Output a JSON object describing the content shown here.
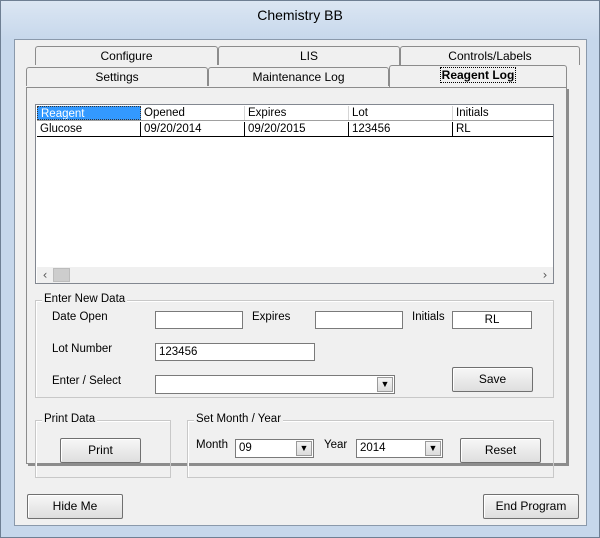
{
  "window": {
    "title": "Chemistry BB"
  },
  "tabs_back": [
    "Configure",
    "LIS",
    "Controls/Labels"
  ],
  "tabs_front": [
    "Settings",
    "Maintenance Log",
    "Reagent Log"
  ],
  "reagent_table": {
    "columns": [
      "Reagent",
      "Opened",
      "Expires",
      "Lot",
      "Initials"
    ],
    "rows": [
      [
        "Glucose",
        "09/20/2014",
        "09/20/2015",
        "123456",
        "RL"
      ]
    ]
  },
  "scrollbar": {
    "left_arrow": "‹",
    "right_arrow": "›"
  },
  "enter_new_data": {
    "title": "Enter New Data",
    "date_open_label": "Date Open",
    "date_open_value": "",
    "expires_label": "Expires",
    "expires_value": "",
    "initials_label": "Initials",
    "initials_value": "RL",
    "lot_number_label": "Lot Number",
    "lot_number_value": "123456",
    "enter_select_label": "Enter / Select",
    "enter_select_value": "",
    "save_label": "Save"
  },
  "print_data": {
    "title": "Print Data",
    "print_label": "Print"
  },
  "set_month_year": {
    "title": "Set Month / Year",
    "month_label": "Month",
    "month_value": "09",
    "year_label": "Year",
    "year_value": "2014",
    "reset_label": "Reset"
  },
  "footer": {
    "hide_me_label": "Hide Me",
    "end_program_label": "End Program"
  },
  "icons": {
    "dropdown": "chevron-down-icon"
  },
  "colors": {
    "selection": "#3399ff",
    "titlebar": "#c6d7eb"
  }
}
